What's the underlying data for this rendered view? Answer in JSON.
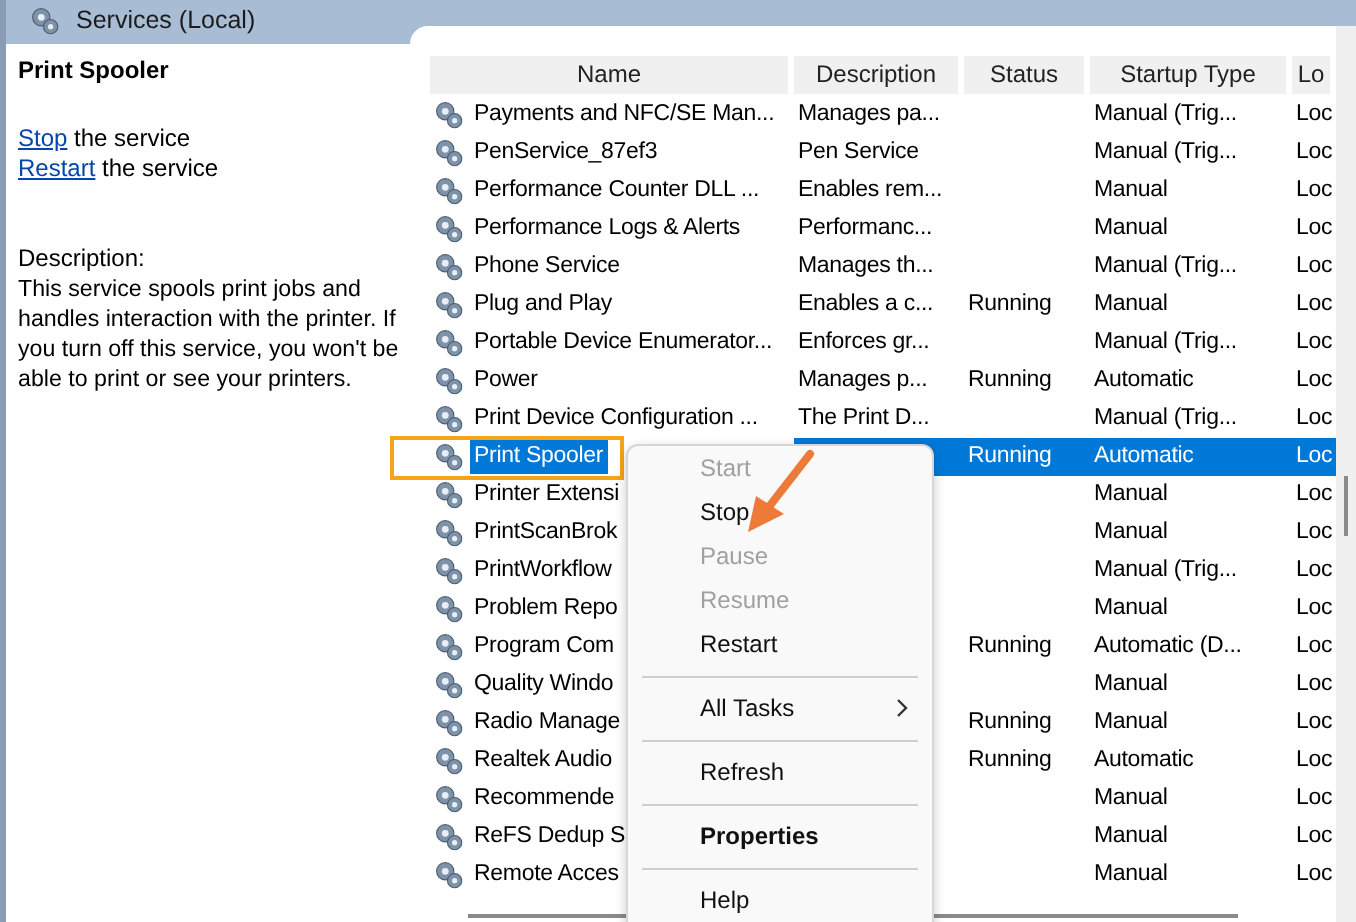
{
  "window": {
    "title": "Services (Local)"
  },
  "left_panel": {
    "service_name": "Print Spooler",
    "actions": [
      {
        "link": "Stop",
        "text": " the service"
      },
      {
        "link": "Restart",
        "text": " the service"
      }
    ],
    "description_label": "Description:",
    "description": "This service spools print jobs and handles interaction with the printer. If you turn off this service, you won't be able to print or see your printers."
  },
  "table": {
    "columns": [
      "Name",
      "Description",
      "Status",
      "Startup Type",
      "Lo"
    ],
    "rows": [
      {
        "name": "Payments and NFC/SE Man...",
        "description": "Manages pa...",
        "status": "",
        "startup": "Manual (Trig...",
        "column_5": "Loc",
        "selected": false,
        "highlighted": false
      },
      {
        "name": "PenService_87ef3",
        "description": "Pen Service",
        "status": "",
        "startup": "Manual (Trig...",
        "column_5": "Loc",
        "selected": false,
        "highlighted": false
      },
      {
        "name": "Performance Counter DLL ...",
        "description": "Enables rem...",
        "status": "",
        "startup": "Manual",
        "column_5": "Loc",
        "selected": false,
        "highlighted": false
      },
      {
        "name": "Performance Logs & Alerts",
        "description": "Performanc...",
        "status": "",
        "startup": "Manual",
        "column_5": "Loc",
        "selected": false,
        "highlighted": false
      },
      {
        "name": "Phone Service",
        "description": "Manages th...",
        "status": "",
        "startup": "Manual (Trig...",
        "column_5": "Loc",
        "selected": false,
        "highlighted": false
      },
      {
        "name": "Plug and Play",
        "description": "Enables a c...",
        "status": "Running",
        "startup": "Manual",
        "column_5": "Loc",
        "selected": false,
        "highlighted": false
      },
      {
        "name": "Portable Device Enumerator...",
        "description": "Enforces gr...",
        "status": "",
        "startup": "Manual (Trig...",
        "column_5": "Loc",
        "selected": false,
        "highlighted": false
      },
      {
        "name": "Power",
        "description": "Manages p...",
        "status": "Running",
        "startup": "Automatic",
        "column_5": "Loc",
        "selected": false,
        "highlighted": false
      },
      {
        "name": "Print Device Configuration ...",
        "description": "The Print D...",
        "status": "",
        "startup": "Manual (Trig...",
        "column_5": "Loc",
        "selected": false,
        "highlighted": false
      },
      {
        "name": "Print Spooler",
        "status": "Running",
        "startup": "Automatic",
        "column_5": "Loc",
        "selected": true,
        "highlighted": true
      },
      {
        "name": "Printer Extensi",
        "status": "",
        "startup": "Manual",
        "column_5": "Loc",
        "selected": false,
        "highlighted": false
      },
      {
        "name": "PrintScanBrok",
        "status": "",
        "startup": "Manual",
        "column_5": "Loc",
        "selected": false,
        "highlighted": false
      },
      {
        "name": "PrintWorkflow",
        "status": "",
        "startup": "Manual (Trig...",
        "column_5": "Loc",
        "selected": false,
        "highlighted": false
      },
      {
        "name": "Problem Repo",
        "status": "",
        "startup": "Manual",
        "column_5": "Loc",
        "selected": false,
        "highlighted": false
      },
      {
        "name": "Program Com",
        "status": "Running",
        "startup": "Automatic (D...",
        "column_5": "Loc",
        "selected": false,
        "highlighted": false
      },
      {
        "name": "Quality Windo",
        "status": "",
        "startup": "Manual",
        "column_5": "Loc",
        "selected": false,
        "highlighted": false
      },
      {
        "name": "Radio Manage",
        "status": "Running",
        "startup": "Manual",
        "column_5": "Loc",
        "selected": false,
        "highlighted": false
      },
      {
        "name": "Realtek Audio",
        "status": "Running",
        "startup": "Automatic",
        "column_5": "Loc",
        "selected": false,
        "highlighted": false
      },
      {
        "name": "Recommende",
        "status": "",
        "startup": "Manual",
        "column_5": "Loc",
        "selected": false,
        "highlighted": false
      },
      {
        "name": "ReFS Dedup S",
        "status": "",
        "startup": "Manual",
        "column_5": "Loc",
        "selected": false,
        "highlighted": false
      },
      {
        "name": "Remote Acces",
        "status": "",
        "startup": "Manual",
        "column_5": "Loc",
        "selected": false,
        "highlighted": false
      }
    ]
  },
  "context_menu": {
    "items": [
      {
        "kind": "item",
        "label": "Start",
        "disabled": true,
        "default": false,
        "submenu": false,
        "pointed": false
      },
      {
        "kind": "item",
        "label": "Stop",
        "disabled": false,
        "default": false,
        "submenu": false,
        "pointed": true
      },
      {
        "kind": "item",
        "label": "Pause",
        "disabled": true,
        "default": false,
        "submenu": false,
        "pointed": false
      },
      {
        "kind": "item",
        "label": "Resume",
        "disabled": true,
        "default": false,
        "submenu": false,
        "pointed": false
      },
      {
        "kind": "item",
        "label": "Restart",
        "disabled": false,
        "default": false,
        "submenu": false,
        "pointed": false
      },
      {
        "kind": "separator"
      },
      {
        "kind": "item",
        "label": "All Tasks",
        "disabled": false,
        "default": false,
        "submenu": true,
        "pointed": false
      },
      {
        "kind": "separator"
      },
      {
        "kind": "item",
        "label": "Refresh",
        "disabled": false,
        "default": false,
        "submenu": false,
        "pointed": false
      },
      {
        "kind": "separator"
      },
      {
        "kind": "item",
        "label": "Properties",
        "disabled": false,
        "default": true,
        "submenu": false,
        "pointed": false
      },
      {
        "kind": "separator"
      },
      {
        "kind": "item",
        "label": "Help",
        "disabled": false,
        "default": false,
        "submenu": false,
        "pointed": false
      }
    ]
  }
}
